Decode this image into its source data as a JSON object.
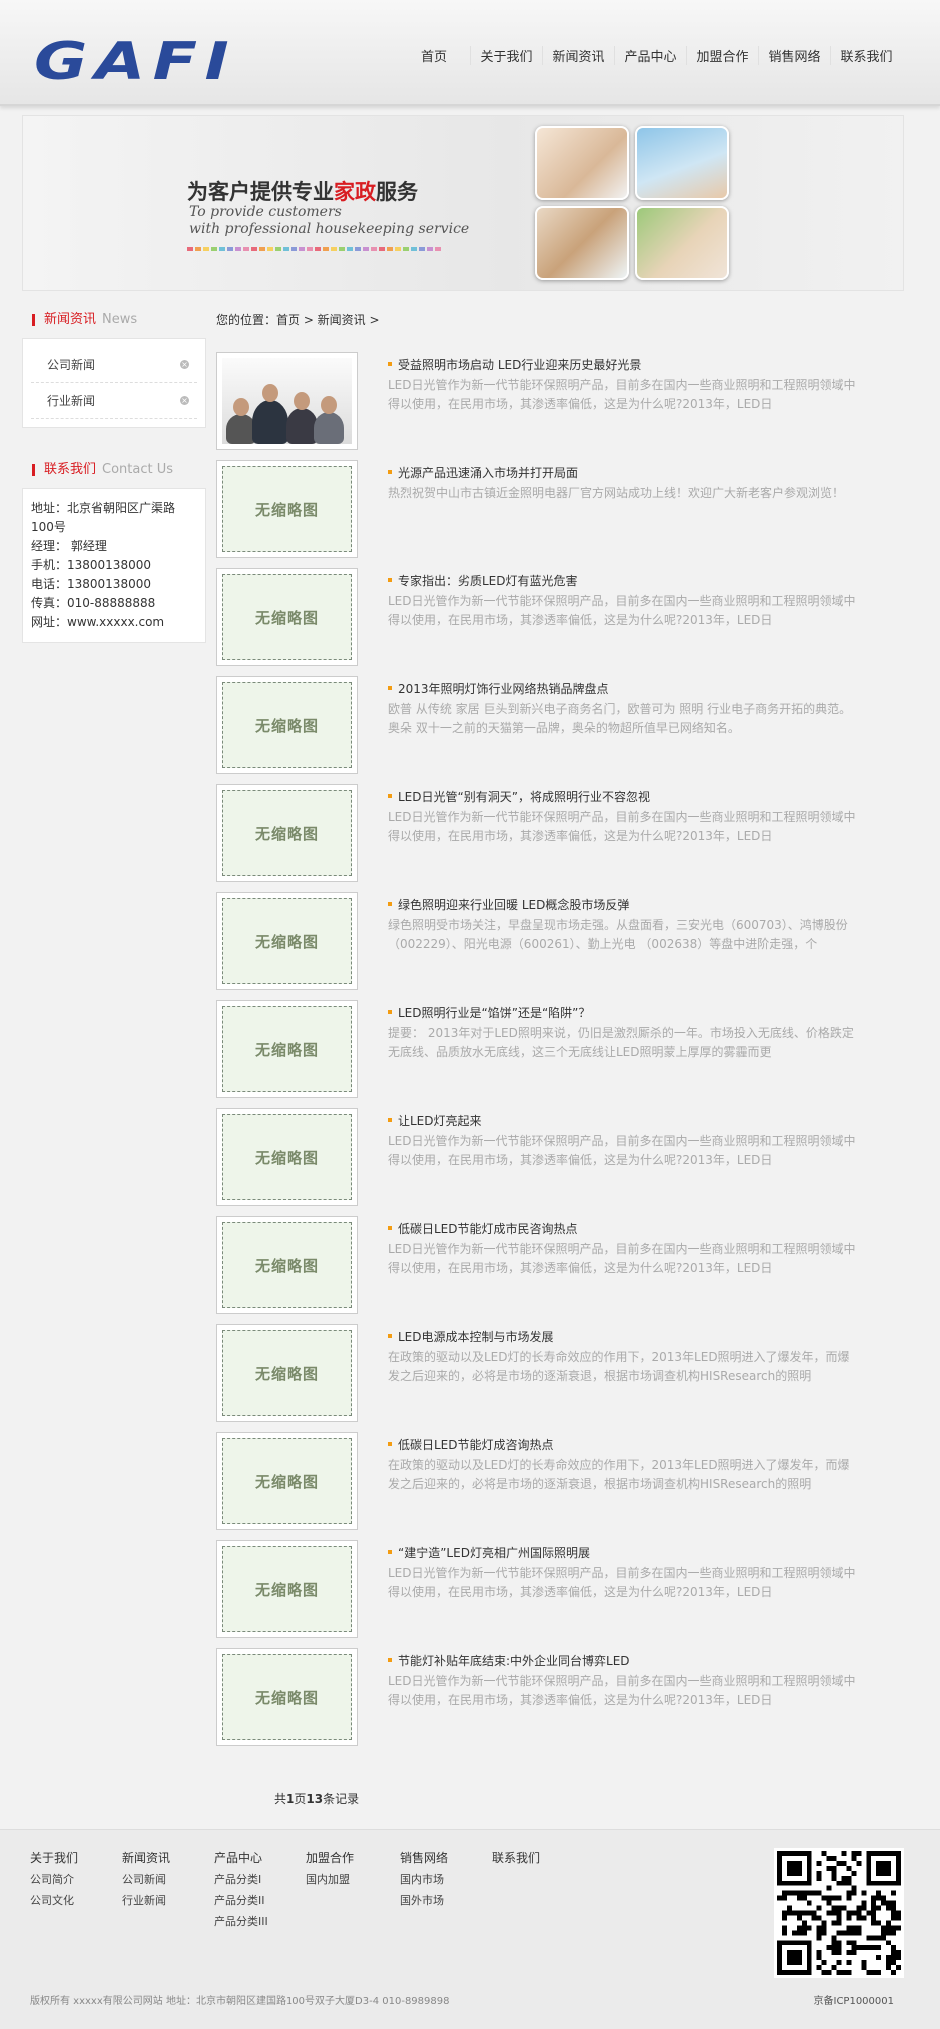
{
  "header": {
    "logo": "GAFI",
    "nav": [
      "首页",
      "关于我们",
      "新闻资讯",
      "产品中心",
      "加盟合作",
      "销售网络",
      "联系我们"
    ]
  },
  "banner": {
    "title_pre": "为客户提供专业",
    "title_hl": "家政",
    "title_post": "服务",
    "en1": "To provide customers",
    "en2": "with professional housekeeping service"
  },
  "sidebar": {
    "news_title": "新闻资讯",
    "news_en": "News",
    "items": [
      "公司新闻",
      "行业新闻"
    ],
    "contact_title": "联系我们",
    "contact_en": "Contact Us",
    "contact_lines": [
      "地址：北京省朝阳区广渠路100号",
      "经理： 郭经理",
      "手机：13800138000",
      "电话：13800138000",
      "传真：010-88888888",
      "网址：www.xxxxx.com"
    ]
  },
  "breadcrumb": "您的位置：首页 > 新闻资讯 >",
  "no_image_text": "无缩略图",
  "articles": [
    {
      "title": "受益照明市场启动 LED行业迎来历史最好光景",
      "desc": "LED日光管作为新一代节能环保照明产品，目前多在国内一些商业照明和工程照明领域中得以使用，在民用市场，其渗透率偏低，这是为什么呢?2013年，LED日"
    },
    {
      "title": "光源产品迅速涌入市场并打开局面",
      "desc": "热烈祝贺中山市古镇近金照明电器厂官方网站成功上线！欢迎广大新老客户参观浏览！"
    },
    {
      "title": "专家指出：劣质LED灯有蓝光危害",
      "desc": "LED日光管作为新一代节能环保照明产品，目前多在国内一些商业照明和工程照明领域中得以使用，在民用市场，其渗透率偏低，这是为什么呢?2013年，LED日"
    },
    {
      "title": "2013年照明灯饰行业网络热销品牌盘点",
      "desc": "欧普 从传统 家居 巨头到新兴电子商务名门，欧普可为 照明 行业电子商务开拓的典范。 奥朵 双十一之前的天猫第一品牌，奥朵的物超所值早已网络知名。"
    },
    {
      "title": "LED日光管“别有洞天”，将成照明行业不容忽视",
      "desc": "LED日光管作为新一代节能环保照明产品，目前多在国内一些商业照明和工程照明领域中得以使用，在民用市场，其渗透率偏低，这是为什么呢?2013年，LED日"
    },
    {
      "title": "绿色照明迎来行业回暖 LED概念股市场反弹",
      "desc": "绿色照明受市场关注，早盘呈现市场走强。从盘面看，三安光电（600703）、鸿博股份（002229）、阳光电源（600261）、勤上光电 （002638）等盘中进阶走强，个"
    },
    {
      "title": "LED照明行业是“馅饼”还是“陷阱”？",
      "desc": "提要： 2013年对于LED照明来说，仍旧是激烈厮杀的一年。市场投入无底线、价格跌定无底线、品质放水无底线，这三个无底线让LED照明蒙上厚厚的雾霾而更"
    },
    {
      "title": "让LED灯亮起来",
      "desc": "LED日光管作为新一代节能环保照明产品，目前多在国内一些商业照明和工程照明领域中得以使用，在民用市场，其渗透率偏低，这是为什么呢?2013年，LED日"
    },
    {
      "title": "低碳日LED节能灯成市民咨询热点",
      "desc": "LED日光管作为新一代节能环保照明产品，目前多在国内一些商业照明和工程照明领域中得以使用，在民用市场，其渗透率偏低，这是为什么呢?2013年，LED日"
    },
    {
      "title": "LED电源成本控制与市场发展",
      "desc": "在政策的驱动以及LED灯的长寿命效应的作用下，2013年LED照明进入了爆发年，而爆发之后迎来的，必将是市场的逐渐衰退，根据市场调查机构HISResearch的照明"
    },
    {
      "title": "低碳日LED节能灯成咨询热点",
      "desc": "在政策的驱动以及LED灯的长寿命效应的作用下，2013年LED照明进入了爆发年，而爆发之后迎来的，必将是市场的逐渐衰退，根据市场调查机构HISResearch的照明"
    },
    {
      "title": "“建宁造”LED灯亮相广州国际照明展",
      "desc": "LED日光管作为新一代节能环保照明产品，目前多在国内一些商业照明和工程照明领域中得以使用，在民用市场，其渗透率偏低，这是为什么呢?2013年，LED日"
    },
    {
      "title": "节能灯补贴年底结束:中外企业同台博弈LED",
      "desc": "LED日光管作为新一代节能环保照明产品，目前多在国内一些商业照明和工程照明领域中得以使用，在民用市场，其渗透率偏低，这是为什么呢?2013年，LED日"
    }
  ],
  "pager": {
    "pre": "共",
    "pages": "1",
    "mid": "页",
    "records": "13",
    "post": "条记录"
  },
  "footer": {
    "columns": [
      {
        "head": "关于我们",
        "items": [
          "公司简介",
          "公司文化"
        ]
      },
      {
        "head": "新闻资讯",
        "items": [
          "公司新闻",
          "行业新闻"
        ]
      },
      {
        "head": "产品中心",
        "items": [
          "产品分类I",
          "产品分类II",
          "产品分类III"
        ]
      },
      {
        "head": "加盟合作",
        "items": [
          "国内加盟"
        ]
      },
      {
        "head": "销售网络",
        "items": [
          "国内市场",
          "国外市场"
        ]
      },
      {
        "head": "联系我们",
        "items": []
      }
    ],
    "copyright": "版权所有 xxxxx有限公司网站 地址：北京市朝阳区建国路100号双子大厦D3-4 010-8989898",
    "icp": "京备ICP1000001"
  }
}
